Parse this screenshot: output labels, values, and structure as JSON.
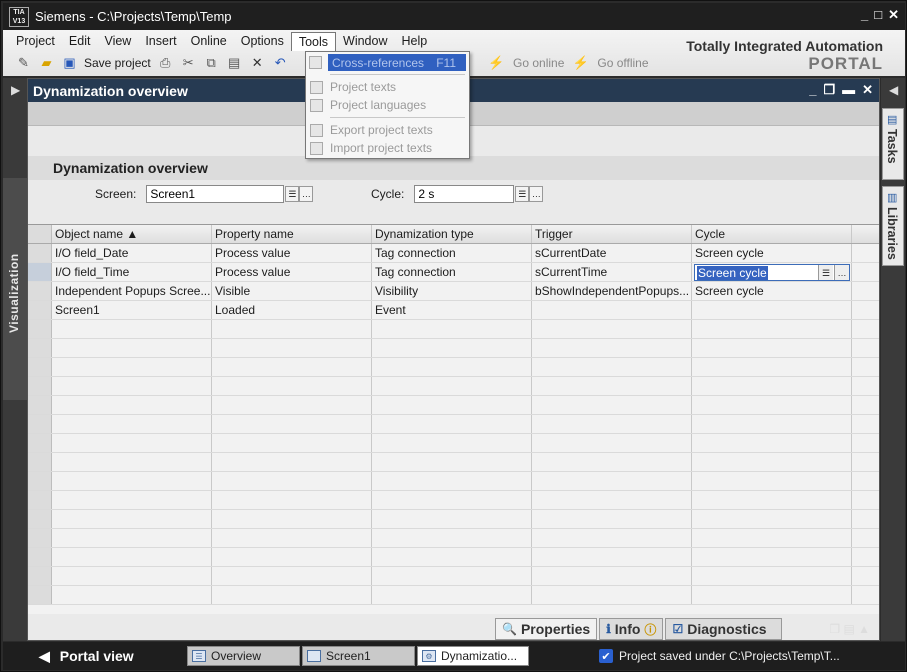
{
  "window": {
    "logo_text": "TIA V13",
    "title": "Siemens  -  C:\\Projects\\Temp\\Temp"
  },
  "menu": [
    "Project",
    "Edit",
    "View",
    "Insert",
    "Online",
    "Options",
    "Tools",
    "Window",
    "Help"
  ],
  "toolbar": {
    "save_label": "Save project",
    "go_online": "Go online",
    "go_offline": "Go offline"
  },
  "brand": {
    "line1": "Totally Integrated Automation",
    "line2": "PORTAL"
  },
  "tools_menu": {
    "items": [
      {
        "label": "Cross-references",
        "shortcut": "F11"
      },
      {
        "label": "Project texts",
        "shortcut": ""
      },
      {
        "label": "Project languages",
        "shortcut": ""
      },
      {
        "label": "Export project texts",
        "shortcut": ""
      },
      {
        "label": "Import project texts",
        "shortcut": ""
      }
    ]
  },
  "left_tab": {
    "label": "Visualization"
  },
  "editor": {
    "header_title": "Dynamization overview",
    "section_title": "Dynamization overview",
    "screen_label": "Screen:",
    "screen_value": "Screen1",
    "cycle_label": "Cycle:",
    "cycle_value": "2 s"
  },
  "table": {
    "columns": [
      "Object name ▲",
      "Property name",
      "Dynamization type",
      "Trigger",
      "Cycle"
    ],
    "rows": [
      [
        "I/O field_Date",
        "Process value",
        "Tag connection",
        "sCurrentDate",
        "Screen cycle"
      ],
      [
        "I/O field_Time",
        "Process value",
        "Tag connection",
        "sCurrentTime",
        "Screen cycle"
      ],
      [
        "Independent Popups Scree...",
        "Visible",
        "Visibility",
        "bShowIndependentPopups...",
        "Screen cycle"
      ],
      [
        "Screen1",
        "Loaded",
        "Event",
        "",
        ""
      ]
    ],
    "editing_value": "Screen cycle"
  },
  "bottom_tabs": [
    "Properties",
    "Info",
    "Diagnostics"
  ],
  "right_tabs": [
    "Tasks",
    "Libraries"
  ],
  "statusbar": {
    "portal_view": "Portal view",
    "tasks": [
      "Overview",
      "Screen1",
      "Dynamizatio..."
    ],
    "message": "Project saved under C:\\Projects\\Temp\\T..."
  }
}
